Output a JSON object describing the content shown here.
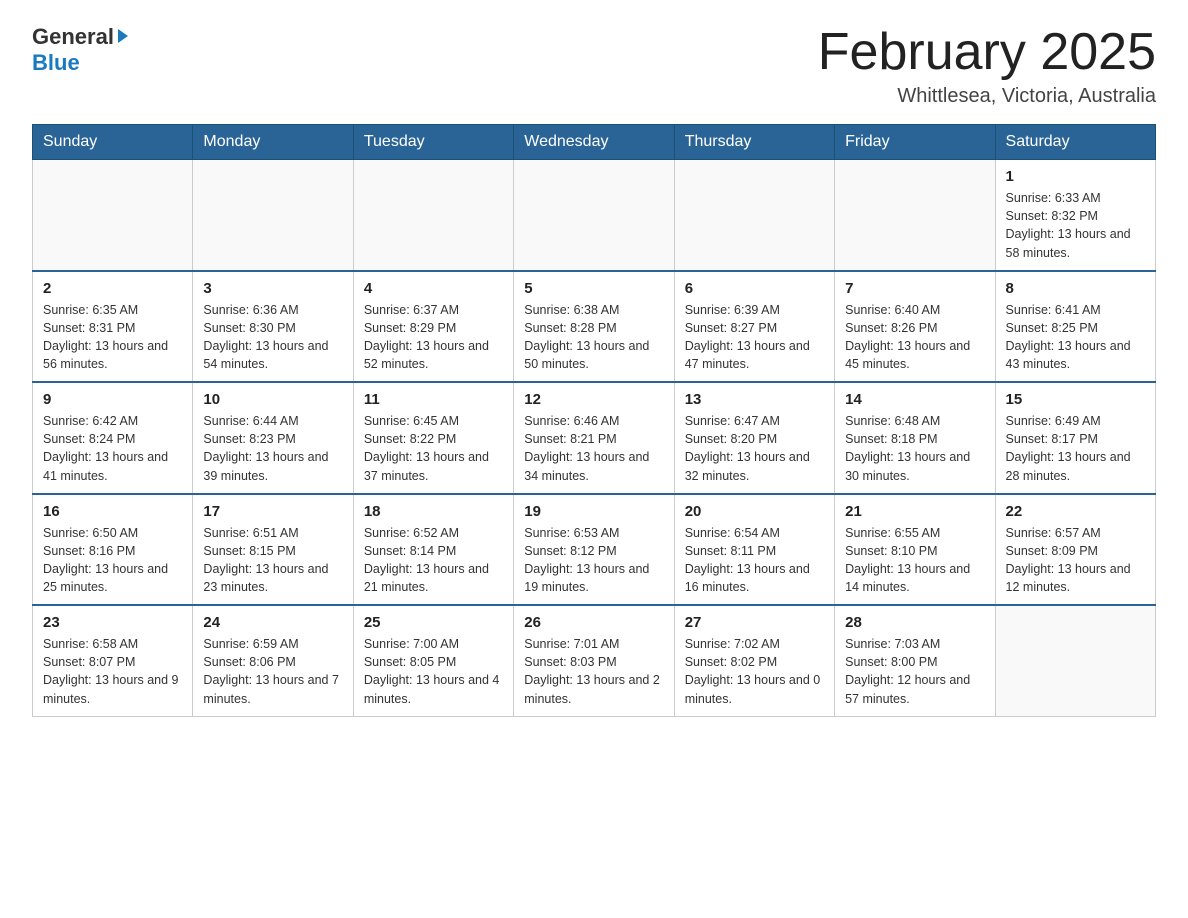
{
  "header": {
    "logo_general": "General",
    "logo_blue": "Blue",
    "month_title": "February 2025",
    "location": "Whittlesea, Victoria, Australia"
  },
  "days_of_week": [
    "Sunday",
    "Monday",
    "Tuesday",
    "Wednesday",
    "Thursday",
    "Friday",
    "Saturday"
  ],
  "weeks": [
    {
      "days": [
        {
          "num": "",
          "info": ""
        },
        {
          "num": "",
          "info": ""
        },
        {
          "num": "",
          "info": ""
        },
        {
          "num": "",
          "info": ""
        },
        {
          "num": "",
          "info": ""
        },
        {
          "num": "",
          "info": ""
        },
        {
          "num": "1",
          "info": "Sunrise: 6:33 AM\nSunset: 8:32 PM\nDaylight: 13 hours and 58 minutes."
        }
      ]
    },
    {
      "days": [
        {
          "num": "2",
          "info": "Sunrise: 6:35 AM\nSunset: 8:31 PM\nDaylight: 13 hours and 56 minutes."
        },
        {
          "num": "3",
          "info": "Sunrise: 6:36 AM\nSunset: 8:30 PM\nDaylight: 13 hours and 54 minutes."
        },
        {
          "num": "4",
          "info": "Sunrise: 6:37 AM\nSunset: 8:29 PM\nDaylight: 13 hours and 52 minutes."
        },
        {
          "num": "5",
          "info": "Sunrise: 6:38 AM\nSunset: 8:28 PM\nDaylight: 13 hours and 50 minutes."
        },
        {
          "num": "6",
          "info": "Sunrise: 6:39 AM\nSunset: 8:27 PM\nDaylight: 13 hours and 47 minutes."
        },
        {
          "num": "7",
          "info": "Sunrise: 6:40 AM\nSunset: 8:26 PM\nDaylight: 13 hours and 45 minutes."
        },
        {
          "num": "8",
          "info": "Sunrise: 6:41 AM\nSunset: 8:25 PM\nDaylight: 13 hours and 43 minutes."
        }
      ]
    },
    {
      "days": [
        {
          "num": "9",
          "info": "Sunrise: 6:42 AM\nSunset: 8:24 PM\nDaylight: 13 hours and 41 minutes."
        },
        {
          "num": "10",
          "info": "Sunrise: 6:44 AM\nSunset: 8:23 PM\nDaylight: 13 hours and 39 minutes."
        },
        {
          "num": "11",
          "info": "Sunrise: 6:45 AM\nSunset: 8:22 PM\nDaylight: 13 hours and 37 minutes."
        },
        {
          "num": "12",
          "info": "Sunrise: 6:46 AM\nSunset: 8:21 PM\nDaylight: 13 hours and 34 minutes."
        },
        {
          "num": "13",
          "info": "Sunrise: 6:47 AM\nSunset: 8:20 PM\nDaylight: 13 hours and 32 minutes."
        },
        {
          "num": "14",
          "info": "Sunrise: 6:48 AM\nSunset: 8:18 PM\nDaylight: 13 hours and 30 minutes."
        },
        {
          "num": "15",
          "info": "Sunrise: 6:49 AM\nSunset: 8:17 PM\nDaylight: 13 hours and 28 minutes."
        }
      ]
    },
    {
      "days": [
        {
          "num": "16",
          "info": "Sunrise: 6:50 AM\nSunset: 8:16 PM\nDaylight: 13 hours and 25 minutes."
        },
        {
          "num": "17",
          "info": "Sunrise: 6:51 AM\nSunset: 8:15 PM\nDaylight: 13 hours and 23 minutes."
        },
        {
          "num": "18",
          "info": "Sunrise: 6:52 AM\nSunset: 8:14 PM\nDaylight: 13 hours and 21 minutes."
        },
        {
          "num": "19",
          "info": "Sunrise: 6:53 AM\nSunset: 8:12 PM\nDaylight: 13 hours and 19 minutes."
        },
        {
          "num": "20",
          "info": "Sunrise: 6:54 AM\nSunset: 8:11 PM\nDaylight: 13 hours and 16 minutes."
        },
        {
          "num": "21",
          "info": "Sunrise: 6:55 AM\nSunset: 8:10 PM\nDaylight: 13 hours and 14 minutes."
        },
        {
          "num": "22",
          "info": "Sunrise: 6:57 AM\nSunset: 8:09 PM\nDaylight: 13 hours and 12 minutes."
        }
      ]
    },
    {
      "days": [
        {
          "num": "23",
          "info": "Sunrise: 6:58 AM\nSunset: 8:07 PM\nDaylight: 13 hours and 9 minutes."
        },
        {
          "num": "24",
          "info": "Sunrise: 6:59 AM\nSunset: 8:06 PM\nDaylight: 13 hours and 7 minutes."
        },
        {
          "num": "25",
          "info": "Sunrise: 7:00 AM\nSunset: 8:05 PM\nDaylight: 13 hours and 4 minutes."
        },
        {
          "num": "26",
          "info": "Sunrise: 7:01 AM\nSunset: 8:03 PM\nDaylight: 13 hours and 2 minutes."
        },
        {
          "num": "27",
          "info": "Sunrise: 7:02 AM\nSunset: 8:02 PM\nDaylight: 13 hours and 0 minutes."
        },
        {
          "num": "28",
          "info": "Sunrise: 7:03 AM\nSunset: 8:00 PM\nDaylight: 12 hours and 57 minutes."
        },
        {
          "num": "",
          "info": ""
        }
      ]
    }
  ]
}
